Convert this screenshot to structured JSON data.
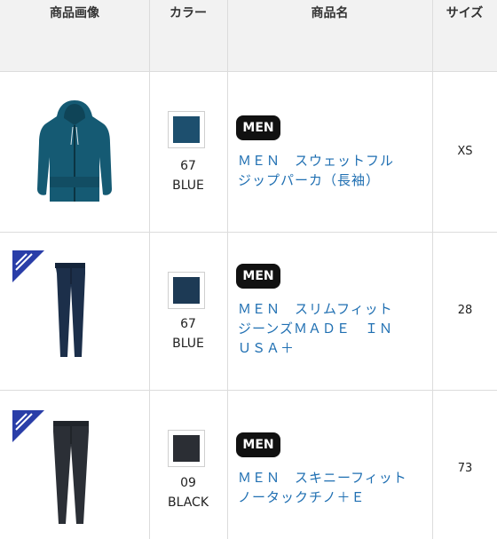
{
  "header": {
    "col_image": "商品画像",
    "col_color": "カラー",
    "col_name": "商品名",
    "col_size": "サイズ"
  },
  "icons": {
    "badge": "new-badge-ribbon-icon"
  },
  "products": [
    {
      "image": "blue-hoodie",
      "swatch_color": "#1d4f6e",
      "color_code": "67",
      "color_name": "BLUE",
      "tag": "MEN",
      "name_line1": "ＭＥＮ　スウェットフル",
      "name_line2": "ジップパーカ（長袖）",
      "name_line3": "",
      "size": "XS"
    },
    {
      "image": "blue-jeans",
      "swatch_color": "#1d3a55",
      "color_code": "67",
      "color_name": "BLUE",
      "tag": "MEN",
      "name_line1": "ＭＥＮ　スリムフィット",
      "name_line2": "ジーンズＭＡＤＥ　ＩＮ",
      "name_line3": "ＵＳＡ＋",
      "size": "28"
    },
    {
      "image": "black-chinos",
      "swatch_color": "#2b2e34",
      "color_code": "09",
      "color_name": "BLACK",
      "tag": "MEN",
      "name_line1": "ＭＥＮ　スキニーフィット",
      "name_line2": "ノータックチノ＋Ｅ",
      "name_line3": "",
      "size": "73"
    }
  ]
}
